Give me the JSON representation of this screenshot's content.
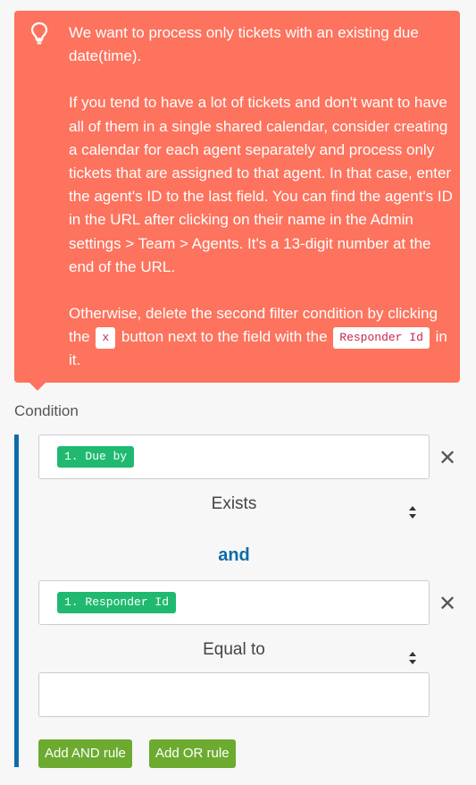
{
  "tooltip": {
    "line1": "We want to process only tickets with an existing due date(time).",
    "paragraph2": "If you tend to have a lot of tickets and don't want to have all of them in a single shared calendar, consider creating a calendar for each agent separately and process only tickets that are assigned to that agent. In that case, enter the agent's ID to the last field. You can find the agent's ID in the URL after clicking on their name in the Admin settings > Team > Agents. It's a 13-digit number at the end of the URL.",
    "para3_before": "Otherwise, delete the second filter condition by clicking the",
    "para3_x": "x",
    "para3_mid": "button next to the field with the",
    "para3_code": "Responder Id",
    "para3_after": "in it."
  },
  "condition": {
    "label": "Condition",
    "rule1": {
      "field_tag": "1. Due by",
      "operator": "Exists"
    },
    "joiner": "and",
    "rule2": {
      "field_tag": "1. Responder Id",
      "operator": "Equal to",
      "value": ""
    }
  },
  "buttons": {
    "add_and": "Add AND rule",
    "add_or": "Add OR rule"
  },
  "colors": {
    "tooltip_bg": "#fd735d",
    "tag_green": "#1fba6f",
    "accent_blue": "#0f6ba8",
    "button_green": "#6cab2f"
  }
}
